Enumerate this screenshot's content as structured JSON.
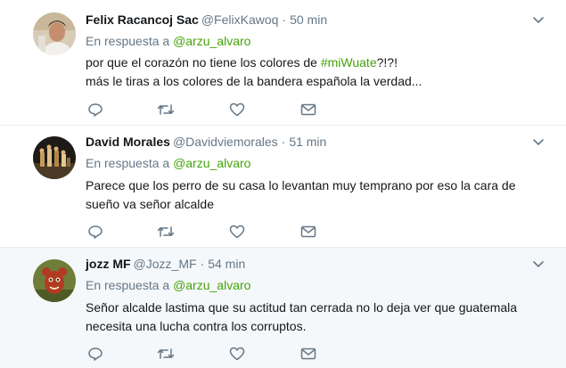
{
  "colors": {
    "link_green": "#45a30a",
    "secondary_text": "#657786",
    "primary_text": "#14171a",
    "highlight_bg": "#f5f8fa"
  },
  "tweets": [
    {
      "fullname": "Felix Racancoj Sac",
      "username": "@FelixKawoq",
      "dot": "·",
      "time": "50 min",
      "reply_prefix": "En respuesta a",
      "reply_mention": "@arzu_alvaro",
      "text_before": "por que el corazón no tiene los colores de ",
      "hashtag": "#miWuate",
      "text_after": "?!?!\nmás le tiras a los colores de la bandera española la verdad...",
      "icons": [
        "reply-icon",
        "retweet-icon",
        "like-icon",
        "direct-message-icon"
      ]
    },
    {
      "fullname": "David Morales",
      "username": "@Davidviemorales",
      "dot": "·",
      "time": "51 min",
      "reply_prefix": "En respuesta a",
      "reply_mention": "@arzu_alvaro",
      "text": "Parece que los perro de su casa lo levantan muy temprano por eso la cara de sueño va señor alcalde",
      "icons": [
        "reply-icon",
        "retweet-icon",
        "like-icon",
        "direct-message-icon"
      ]
    },
    {
      "fullname": "jozz MF",
      "username": "@Jozz_MF",
      "dot": "·",
      "time": "54 min",
      "reply_prefix": "En respuesta a",
      "reply_mention": "@arzu_alvaro",
      "text": "Señor alcalde lastima que su actitud tan cerrada no lo deja ver que guatemala necesita una lucha contra los corruptos.",
      "icons": [
        "reply-icon",
        "retweet-icon",
        "like-icon",
        "direct-message-icon"
      ]
    }
  ]
}
